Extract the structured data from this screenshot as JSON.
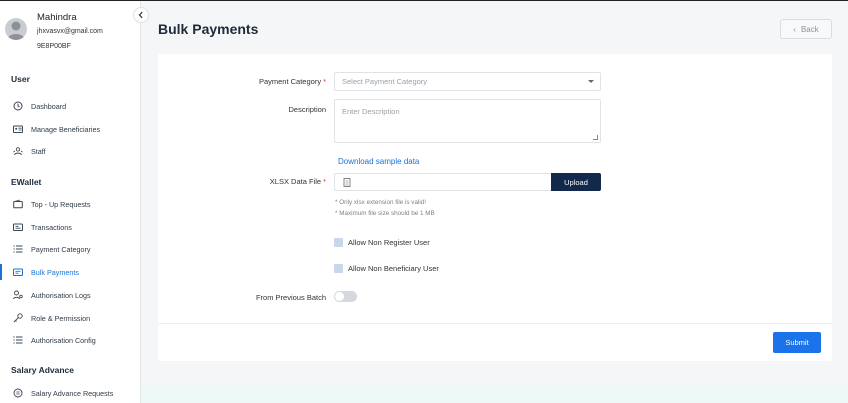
{
  "user": {
    "name": "Mahindra",
    "email": "jhxvasvx@gmail.com",
    "id": "9E8P00BF"
  },
  "sidebar": {
    "sections": [
      {
        "title": "User"
      },
      {
        "title": "EWallet"
      },
      {
        "title": "Salary Advance"
      }
    ],
    "items": [
      {
        "label": "Dashboard",
        "icon": "clock-icon"
      },
      {
        "label": "Manage Beneficiaries",
        "icon": "id-card-icon"
      },
      {
        "label": "Staff",
        "icon": "staff-icon"
      },
      {
        "label": "Top - Up Requests",
        "icon": "wallet-icon"
      },
      {
        "label": "Transactions",
        "icon": "transactions-icon"
      },
      {
        "label": "Payment Category",
        "icon": "list-icon"
      },
      {
        "label": "Bulk Payments",
        "icon": "bulk-payments-icon",
        "active": true
      },
      {
        "label": "Authorisation Logs",
        "icon": "authorisation-logs-icon"
      },
      {
        "label": "Role & Permission",
        "icon": "key-icon"
      },
      {
        "label": "Authorisation Config",
        "icon": "config-list-icon"
      },
      {
        "label": "Salary Advance Requests",
        "icon": "salary-advance-icon"
      }
    ]
  },
  "header": {
    "title": "Bulk Payments",
    "back_label": "Back"
  },
  "form": {
    "payment_category": {
      "label": "Payment Category",
      "required_mark": "*",
      "placeholder": "Select Payment Category"
    },
    "description": {
      "label": "Description",
      "placeholder": "Enter Description"
    },
    "download_sample": "Download sample data",
    "xlsx_file": {
      "label": "XLSX Data File",
      "required_mark": "*",
      "upload_label": "Upload"
    },
    "hints": [
      "* Only xlsx extension file is valid!",
      "* Maximum file size should be 1 MB"
    ],
    "allow_non_register": "Allow Non Register User",
    "allow_non_beneficiary": "Allow Non Beneficiary User",
    "from_previous_batch": {
      "label": "From Previous Batch",
      "enabled": false
    },
    "submit_label": "Submit"
  },
  "colors": {
    "accent": "#1a73e8",
    "upload_button": "#13294b",
    "required": "#e0322f"
  }
}
